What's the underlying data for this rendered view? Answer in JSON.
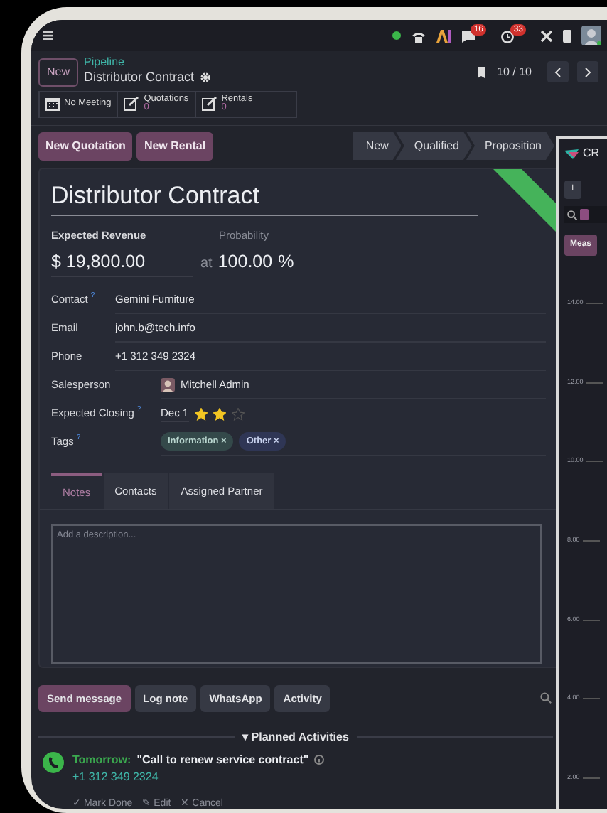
{
  "top_bar": {
    "message_count": "16",
    "activity_count": "33"
  },
  "breadcrumb": {
    "new_button": "New",
    "parent": "Pipeline",
    "current": "Distributor Contract"
  },
  "pager": "10 / 10",
  "smart_buttons": [
    {
      "kind": "calendar",
      "label": "No Meeting"
    },
    {
      "kind": "edit",
      "label": "Quotations",
      "count": "0"
    },
    {
      "kind": "edit",
      "label": "Rentals",
      "count": "0"
    }
  ],
  "action_buttons": [
    "New Quotation",
    "New Rental"
  ],
  "stages": [
    {
      "label": "New",
      "selected": false
    },
    {
      "label": "Qualified",
      "selected": false
    },
    {
      "label": "Proposition",
      "selected": false
    }
  ],
  "record": {
    "title": "Distributor Contract",
    "revenue_label": "Expected Revenue",
    "revenue": "$ 19,800.00",
    "probability_label": "Probability",
    "at": "at",
    "probability": "100.00",
    "percent": "%"
  },
  "fields": [
    {
      "kind": "text",
      "label": "Contact",
      "help": "?",
      "value": "Gemini Furniture"
    },
    {
      "kind": "text",
      "label": "Email",
      "value": "john.b@tech.info"
    },
    {
      "kind": "text",
      "label": "Phone",
      "value": "+1 312 349 2324"
    },
    {
      "kind": "user",
      "label": "Salesperson",
      "value": "Mitchell Admin"
    },
    {
      "kind": "date",
      "label": "Expected Closing",
      "help": "?",
      "value": "Dec 1",
      "stars": 2
    },
    {
      "kind": "tags",
      "label": "Tags",
      "help": "?",
      "tags": [
        {
          "label": "Information ×",
          "color": "#34494a"
        },
        {
          "label": "Other ×",
          "color": "#2f3655"
        }
      ]
    }
  ],
  "tabs": [
    {
      "label": "Notes",
      "selected": true
    },
    {
      "label": "Contacts",
      "selected": false
    },
    {
      "label": "Assigned Partner",
      "selected": false
    }
  ],
  "description": {
    "placeholder": "Add a description..."
  },
  "chatter_buttons": [
    {
      "label": "Send message",
      "primary": true
    },
    {
      "label": "Log note",
      "primary": false
    },
    {
      "label": "WhatsApp",
      "primary": false
    },
    {
      "label": "Activity",
      "primary": false
    }
  ],
  "planned_activities": {
    "title": "▾ Planned Activities",
    "items": [
      {
        "due": "Tomorrow:",
        "summary": "\"Call to renew service contract\"",
        "phone": "+1 312 349 2324",
        "actions": [
          "✓ Mark Done",
          "✎ Edit",
          "✕ Cancel"
        ]
      }
    ]
  },
  "second_window": {
    "title": "CR",
    "button": "I",
    "measure_button": "Meas",
    "y_axis_labels": [
      "14.00",
      "12.00",
      "10.00",
      "8.00",
      "6.00",
      "4.00",
      "2.00"
    ]
  }
}
